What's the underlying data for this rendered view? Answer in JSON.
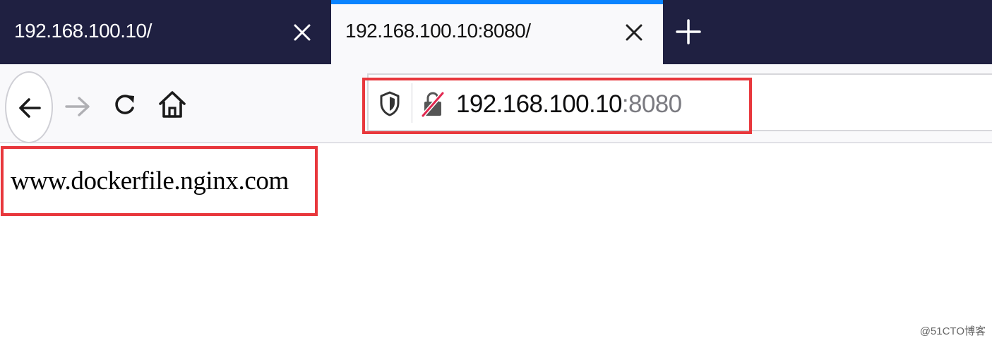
{
  "tabs": [
    {
      "title": "192.168.100.10/",
      "active": false
    },
    {
      "title": "192.168.100.10:8080/",
      "active": true
    }
  ],
  "colors": {
    "tabstrip_bg": "#1f2041",
    "active_tab_indicator": "#0a84ff",
    "highlight_box": "#e8373c"
  },
  "icons": {
    "tab_close": "close-icon",
    "new_tab": "plus-icon",
    "back": "arrow-left-icon",
    "forward": "arrow-right-icon",
    "reload": "reload-icon",
    "home": "home-icon",
    "tracking_protection": "shield-icon",
    "insecure_connection": "lock-crossed-icon"
  },
  "urlbar": {
    "host": "192.168.100.10",
    "port": ":8080"
  },
  "page": {
    "body_text": "www.dockerfile.nginx.com"
  },
  "watermark": "@51CTO博客"
}
